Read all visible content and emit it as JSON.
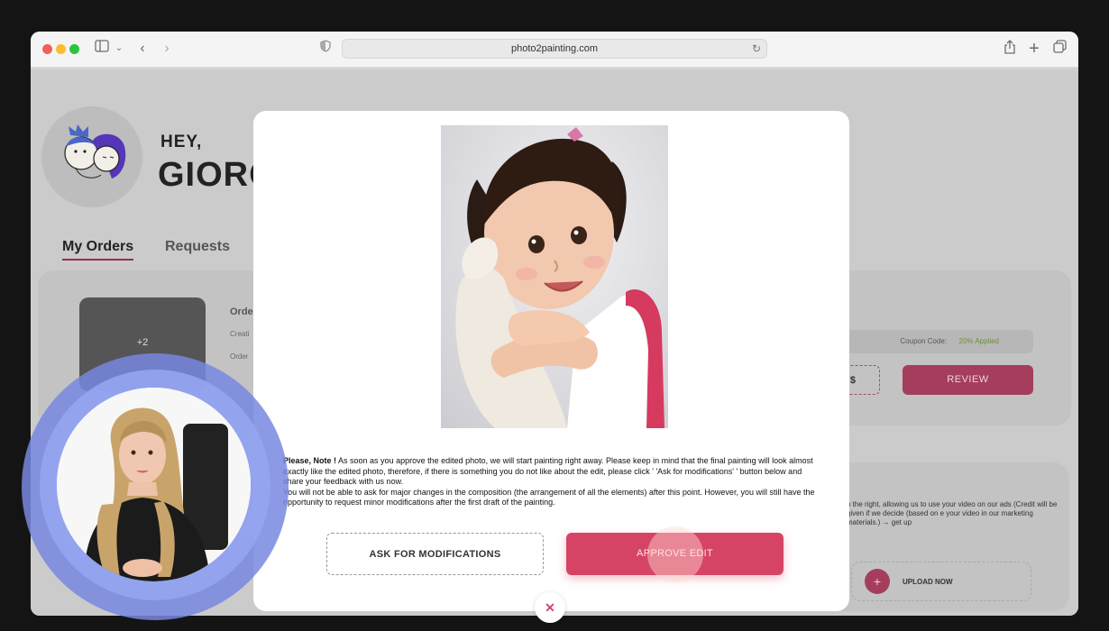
{
  "browser": {
    "url": "photo2painting.com",
    "icons": [
      "sidebar-icon",
      "chevron-down-icon",
      "back-icon",
      "forward-icon",
      "shield-icon",
      "reload-icon",
      "share-icon",
      "new-tab-icon",
      "tabs-icon"
    ]
  },
  "header": {
    "greeting": "HEY,",
    "name": "GIORG"
  },
  "tabs": [
    {
      "label": "My Orders",
      "active": true
    },
    {
      "label": "Requests",
      "active": false
    }
  ],
  "order": {
    "thumb_count": "+2",
    "title": "Orde",
    "created": "Creati",
    "order_line": "Order",
    "coupon_label": "Coupon Code:",
    "coupon_value": "20% Applied",
    "price_fragment": "$",
    "review_label": "REVIEW"
  },
  "promo": {
    "text": "n the right, allowing us to use your video on our ads (Credit will be given if we decide (based on e your video in our marketing materials.) → get up",
    "upload_label": "UPLOAD NOW"
  },
  "modal": {
    "note_bold": "Please, Note !",
    "note_text": " As soon as you approve the edited photo, we will start painting right away. Please keep in mind that the final painting will look almost exactly like the edited photo, therefore, if there is something you do not like about the edit, please click ' 'Ask for modifications' ' button below and share your feedback with us now.",
    "note_text2": "You will not be able to ask for major changes in the composition (the arrangement of all the elements) after this point. However, you will still have the opportunity to request minor modifications after the first draft of the painting.",
    "ask_label": "ASK FOR MODIFICATIONS",
    "approve_label": "APPROVE EDIT",
    "close_symbol": "✕"
  },
  "colors": {
    "accent": "#d64465",
    "pip_ring": "#7887e1"
  }
}
